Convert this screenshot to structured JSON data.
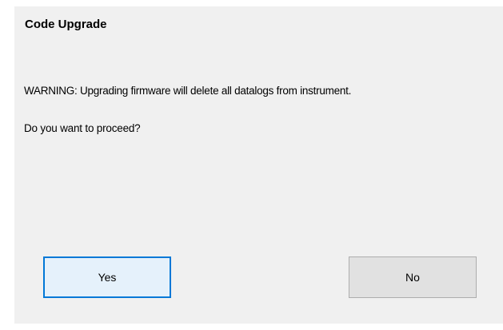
{
  "dialog": {
    "title": "Code Upgrade",
    "warning_text": "WARNING: Upgrading firmware will delete all datalogs from instrument.",
    "question_text": "Do you want to proceed?",
    "buttons": {
      "yes_label": "Yes",
      "no_label": "No"
    }
  },
  "colors": {
    "dialog_background": "#f0f0f0",
    "focused_button_border": "#0078d7",
    "button_background": "#e1e1e1"
  }
}
